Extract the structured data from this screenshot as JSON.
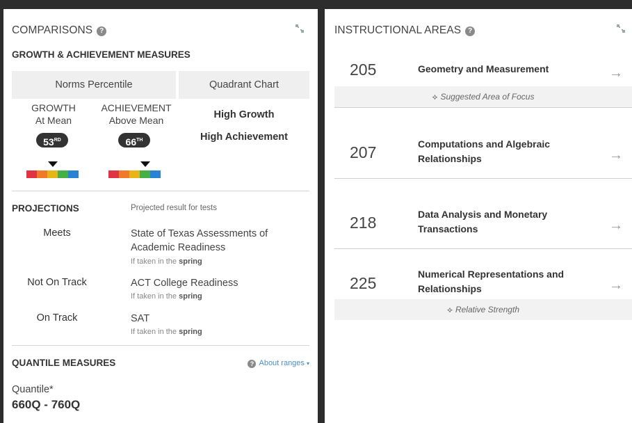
{
  "comparisons": {
    "title": "COMPARISONS",
    "help": "?",
    "measures_title": "GROWTH & ACHIEVEMENT MEASURES",
    "norms_tab": "Norms Percentile",
    "quadrant_tab": "Quadrant Chart",
    "growth": {
      "label": "GROWTH",
      "desc": "At Mean",
      "value": "53",
      "suffix": "RD",
      "level": 3
    },
    "achievement": {
      "label": "ACHIEVEMENT",
      "desc": "Above Mean",
      "value": "66",
      "suffix": "TH",
      "level": 4
    },
    "band_colors": [
      "#e03344",
      "#f07a2a",
      "#e8b417",
      "#45b046",
      "#2a82d4"
    ],
    "quadrant_line1": "High Growth",
    "quadrant_line2": "High Achievement"
  },
  "projections": {
    "title": "PROJECTIONS",
    "subtitle": "Projected result for tests",
    "rows": [
      {
        "status": "Meets",
        "test": "State of Texas Assessments of Academic Readiness",
        "note_prefix": "If taken in the",
        "note_season": "spring"
      },
      {
        "status": "Not On Track",
        "test": "ACT College Readiness",
        "note_prefix": "If taken in the",
        "note_season": "spring"
      },
      {
        "status": "On Track",
        "test": "SAT",
        "note_prefix": "If taken in the",
        "note_season": "spring"
      }
    ]
  },
  "quantile": {
    "title": "QUANTILE MEASURES",
    "about": "About ranges",
    "label": "Quantile*",
    "value": "660Q - 760Q"
  },
  "instructional": {
    "title": "INSTRUCTIONAL AREAS",
    "help": "?",
    "areas": [
      {
        "score": "205",
        "name": "Geometry and Measurement",
        "tag": "Suggested Area of Focus"
      },
      {
        "score": "207",
        "name": "Computations and Algebraic Relationships",
        "tag": ""
      },
      {
        "score": "218",
        "name": "Data Analysis and Monetary Transactions",
        "tag": ""
      },
      {
        "score": "225",
        "name": "Numerical Representations and Relationships",
        "tag": "Relative Strength"
      }
    ],
    "arrow": "→",
    "tag_icon": "crosshair-diamond-icon"
  }
}
